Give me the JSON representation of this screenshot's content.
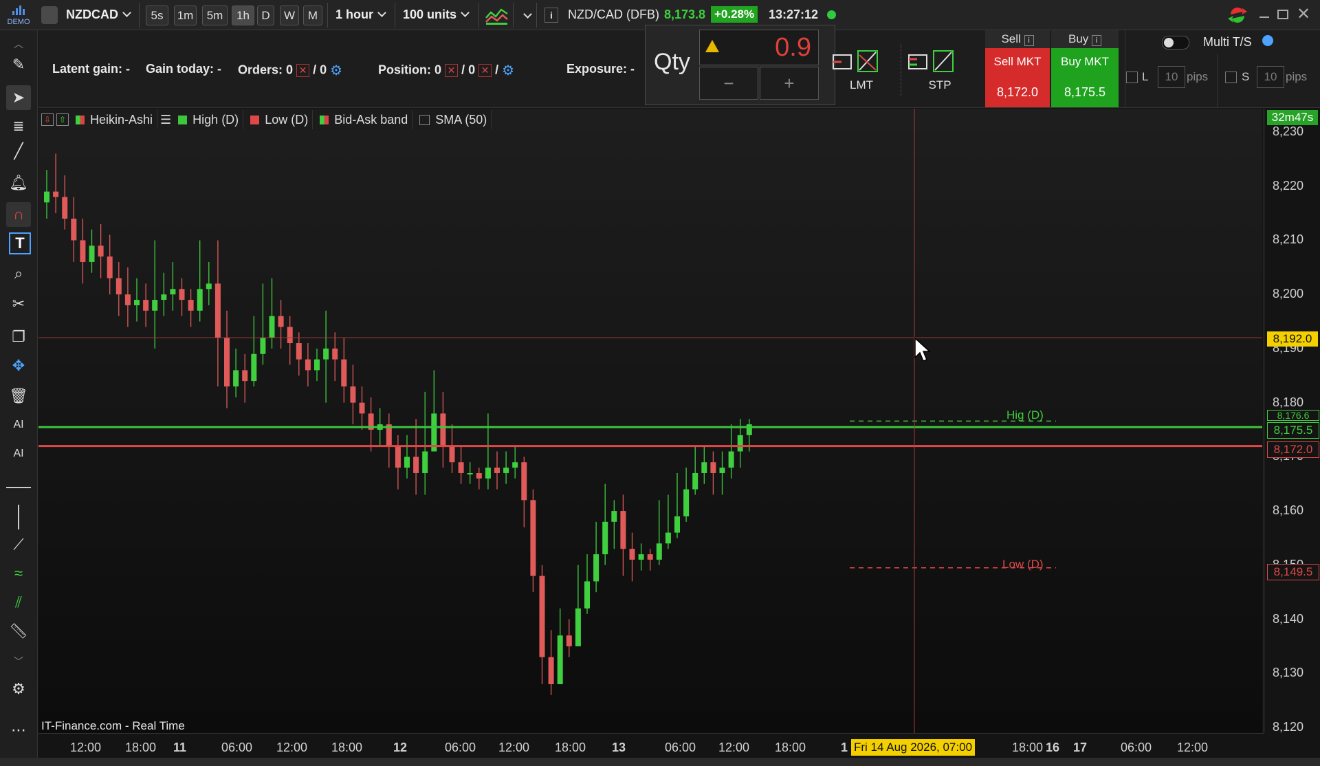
{
  "topbar": {
    "logo_text": "DEMO",
    "symbol_select": "NZDCAD",
    "timeframes": [
      "5s",
      "1m",
      "5m",
      "1h",
      "D",
      "W",
      "M"
    ],
    "active_timeframe": "1h",
    "interval_select": "1 hour",
    "units_select": "100 units",
    "instrument": "NZD/CAD (DFB)",
    "price": "8,173.8",
    "change": "+0.28%",
    "time": "13:27:12",
    "colors": {
      "price": "#3bd13b",
      "change_bg": "#21a521",
      "status_dot": "#2ecc40"
    }
  },
  "stats": {
    "latent_gain_label": "Latent gain:",
    "latent_gain_value": "-",
    "gain_today_label": "Gain today:",
    "gain_today_value": "-",
    "orders_label": "Orders:",
    "orders_value": "0",
    "orders_total": "/ 0",
    "position_label": "Position:",
    "position_value": "0",
    "position_total": "/ 0",
    "position_sep": "/",
    "exposure_label": "Exposure:",
    "exposure_value": "-"
  },
  "qty": {
    "label": "Qty",
    "value": "0.9",
    "minus": "−",
    "plus": "+"
  },
  "order_types": {
    "limit": "LMT",
    "stop": "STP"
  },
  "trade": {
    "sell_header": "Sell",
    "buy_header": "Buy",
    "sell_label": "Sell MKT",
    "buy_label": "Buy MKT",
    "sell_price": "8,172.0",
    "buy_price": "8,175.5",
    "multi_ts": "Multi T/S",
    "long_label": "L",
    "short_label": "S",
    "pips_value_l": "10",
    "pips_value_s": "10",
    "pips_unit": "pips"
  },
  "legend": {
    "items": [
      {
        "label": "Heikin-Ashi",
        "color": "#d64545"
      },
      {
        "label": "High (D)",
        "color": "#3cc73c"
      },
      {
        "label": "Low (D)",
        "color": "#e04848"
      },
      {
        "label": "Bid-Ask band",
        "color": "#d64545"
      },
      {
        "label": "SMA (50)",
        "color": ""
      }
    ]
  },
  "chart_labels": {
    "countdown": "32m47s",
    "cursor_price": "8,192.0",
    "high_tag": "8,176.6",
    "ask_tag": "8,175.5",
    "bid_tag": "8,172.0",
    "low_tag": "8,149.5",
    "high_line_label": "Hig (D)",
    "low_line_label": "Low (D)",
    "cursor_date": "Fri 14 Aug 2026, 07:00",
    "source": "IT-Finance.com - Real Time"
  },
  "chart_data": {
    "type": "candlestick",
    "y_ticks": [
      "8,230",
      "8,220",
      "8,210",
      "8,200",
      "8,190",
      "8,180",
      "8,170",
      "8,160",
      "8,150",
      "8,140",
      "8,130",
      "8,120"
    ],
    "ylim": [
      8118,
      8233
    ],
    "x_ticks": [
      "12:00",
      "18:00",
      "11",
      "06:00",
      "12:00",
      "18:00",
      "12",
      "06:00",
      "12:00",
      "18:00",
      "13",
      "06:00",
      "12:00",
      "18:00",
      "1",
      "18:00",
      "16",
      "17",
      "06:00",
      "12:00"
    ],
    "levels": {
      "high_d": 8176.6,
      "ask": 8175.5,
      "bid": 8172.0,
      "low_d": 8149.5,
      "cursor": 8192.0
    },
    "colors": {
      "up": "#3fcf3f",
      "down": "#e05a5a",
      "bid_line": "#e04848",
      "ask_line": "#3cc73c"
    },
    "candles": [
      [
        8217,
        8219,
        8223,
        8214
      ],
      [
        8219,
        8218,
        8226,
        8215
      ],
      [
        8218,
        8214,
        8222,
        8212
      ],
      [
        8214,
        8210,
        8218,
        8206
      ],
      [
        8210,
        8206,
        8214,
        8202
      ],
      [
        8206,
        8209,
        8212,
        8204
      ],
      [
        8209,
        8207,
        8213,
        8203
      ],
      [
        8207,
        8203,
        8211,
        8200
      ],
      [
        8203,
        8200,
        8206,
        8196
      ],
      [
        8200,
        8198,
        8205,
        8194
      ],
      [
        8198,
        8199,
        8203,
        8195
      ],
      [
        8199,
        8197,
        8202,
        8194
      ],
      [
        8197,
        8199,
        8210,
        8190
      ],
      [
        8199,
        8200,
        8204,
        8196
      ],
      [
        8200,
        8201,
        8206,
        8197
      ],
      [
        8201,
        8199,
        8203,
        8196
      ],
      [
        8199,
        8197,
        8201,
        8194
      ],
      [
        8197,
        8201,
        8210,
        8195
      ],
      [
        8201,
        8202,
        8206,
        8198
      ],
      [
        8202,
        8192,
        8210,
        8183
      ],
      [
        8192,
        8183,
        8197,
        8179
      ],
      [
        8183,
        8186,
        8190,
        8181
      ],
      [
        8186,
        8184,
        8189,
        8180
      ],
      [
        8184,
        8189,
        8196,
        8183
      ],
      [
        8189,
        8192,
        8202,
        8187
      ],
      [
        8192,
        8196,
        8203,
        8190
      ],
      [
        8196,
        8194,
        8199,
        8190
      ],
      [
        8194,
        8191,
        8196,
        8187
      ],
      [
        8191,
        8188,
        8193,
        8185
      ],
      [
        8188,
        8186,
        8191,
        8183
      ],
      [
        8186,
        8188,
        8190,
        8184
      ],
      [
        8188,
        8190,
        8197,
        8180
      ],
      [
        8190,
        8188,
        8193,
        8184
      ],
      [
        8188,
        8183,
        8192,
        8180
      ],
      [
        8183,
        8180,
        8187,
        8176
      ],
      [
        8180,
        8178,
        8183,
        8175
      ],
      [
        8178,
        8175,
        8181,
        8171
      ],
      [
        8175,
        8176,
        8179,
        8172
      ],
      [
        8176,
        8172,
        8178,
        8168
      ],
      [
        8172,
        8168,
        8174,
        8164
      ],
      [
        8168,
        8170,
        8174,
        8166
      ],
      [
        8170,
        8167,
        8177,
        8163
      ],
      [
        8167,
        8171,
        8182,
        8163
      ],
      [
        8171,
        8178,
        8186,
        8172
      ],
      [
        8178,
        8172,
        8182,
        8168
      ],
      [
        8172,
        8169,
        8176,
        8167
      ],
      [
        8169,
        8167,
        8172,
        8165
      ],
      [
        8167,
        8167,
        8169,
        8165
      ],
      [
        8167,
        8166,
        8168,
        8164
      ],
      [
        8166,
        8168,
        8178,
        8164
      ],
      [
        8168,
        8167,
        8171,
        8164
      ],
      [
        8167,
        8168,
        8171,
        8165
      ],
      [
        8168,
        8169,
        8172,
        8166
      ],
      [
        8169,
        8162,
        8170,
        8157
      ],
      [
        8162,
        8148,
        8164,
        8145
      ],
      [
        8148,
        8133,
        8150,
        8128
      ],
      [
        8133,
        8128,
        8138,
        8126
      ],
      [
        8128,
        8137,
        8142,
        8133
      ],
      [
        8137,
        8135,
        8140,
        8133
      ],
      [
        8135,
        8142,
        8150,
        8138
      ],
      [
        8142,
        8147,
        8152,
        8141
      ],
      [
        8147,
        8152,
        8158,
        8145
      ],
      [
        8152,
        8158,
        8165,
        8150
      ],
      [
        8158,
        8160,
        8162,
        8153
      ],
      [
        8160,
        8153,
        8163,
        8148
      ],
      [
        8153,
        8151,
        8156,
        8147
      ],
      [
        8151,
        8152,
        8154,
        8149
      ],
      [
        8152,
        8151,
        8153,
        8149
      ],
      [
        8151,
        8154,
        8162,
        8150
      ],
      [
        8154,
        8156,
        8163,
        8153
      ],
      [
        8156,
        8159,
        8167,
        8155
      ],
      [
        8159,
        8164,
        8168,
        8158
      ],
      [
        8164,
        8167,
        8172,
        8163
      ],
      [
        8167,
        8169,
        8172,
        8165
      ],
      [
        8169,
        8167,
        8171,
        8163
      ],
      [
        8167,
        8168,
        8171,
        8163
      ],
      [
        8168,
        8171,
        8176,
        8166
      ],
      [
        8171,
        8174,
        8177,
        8168
      ],
      [
        8174,
        8176,
        8177,
        8171
      ]
    ]
  }
}
